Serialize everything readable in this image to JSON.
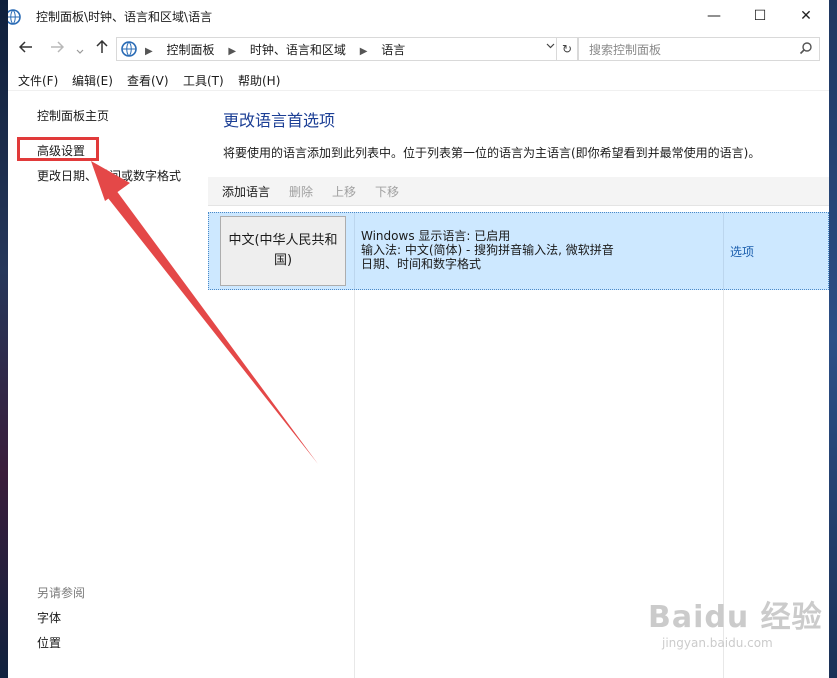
{
  "window": {
    "title": "控制面板\\时钟、语言和区域\\语言",
    "caption": {
      "minimize": "—",
      "maximize": "☐",
      "close": "✕"
    }
  },
  "addressbar": {
    "breadcrumbs": [
      "控制面板",
      "时钟、语言和区域",
      "语言"
    ],
    "search_placeholder": "搜索控制面板"
  },
  "menu": [
    "文件(F)",
    "编辑(E)",
    "查看(V)",
    "工具(T)",
    "帮助(H)"
  ],
  "sidebar": {
    "home": "控制面板主页",
    "advanced": "高级设置",
    "date_format": "更改日期、时间或数字格式",
    "see_also_heading": "另请参阅",
    "see_also": [
      "字体",
      "位置"
    ]
  },
  "main": {
    "title": "更改语言首选项",
    "description": "将要使用的语言添加到此列表中。位于列表第一位的语言为主语言(即你希望看到并最常使用的语言)。",
    "toolbar": {
      "add": "添加语言",
      "remove": "删除",
      "up": "上移",
      "down": "下移"
    },
    "languages": [
      {
        "name": "中文(中华人民共和国)",
        "details": [
          "Windows 显示语言: 已启用",
          "输入法: 中文(简体) - 搜狗拼音输入法, 微软拼音",
          "日期、时间和数字格式"
        ],
        "options": "选项"
      }
    ]
  },
  "watermark": {
    "brand": "Baidu 经验",
    "site": "jingyan.baidu.com"
  },
  "colors": {
    "title_blue": "#1c3f95",
    "selection": "#cde8ff",
    "link": "#1c5fae",
    "highlight_red": "#e13a3a"
  }
}
